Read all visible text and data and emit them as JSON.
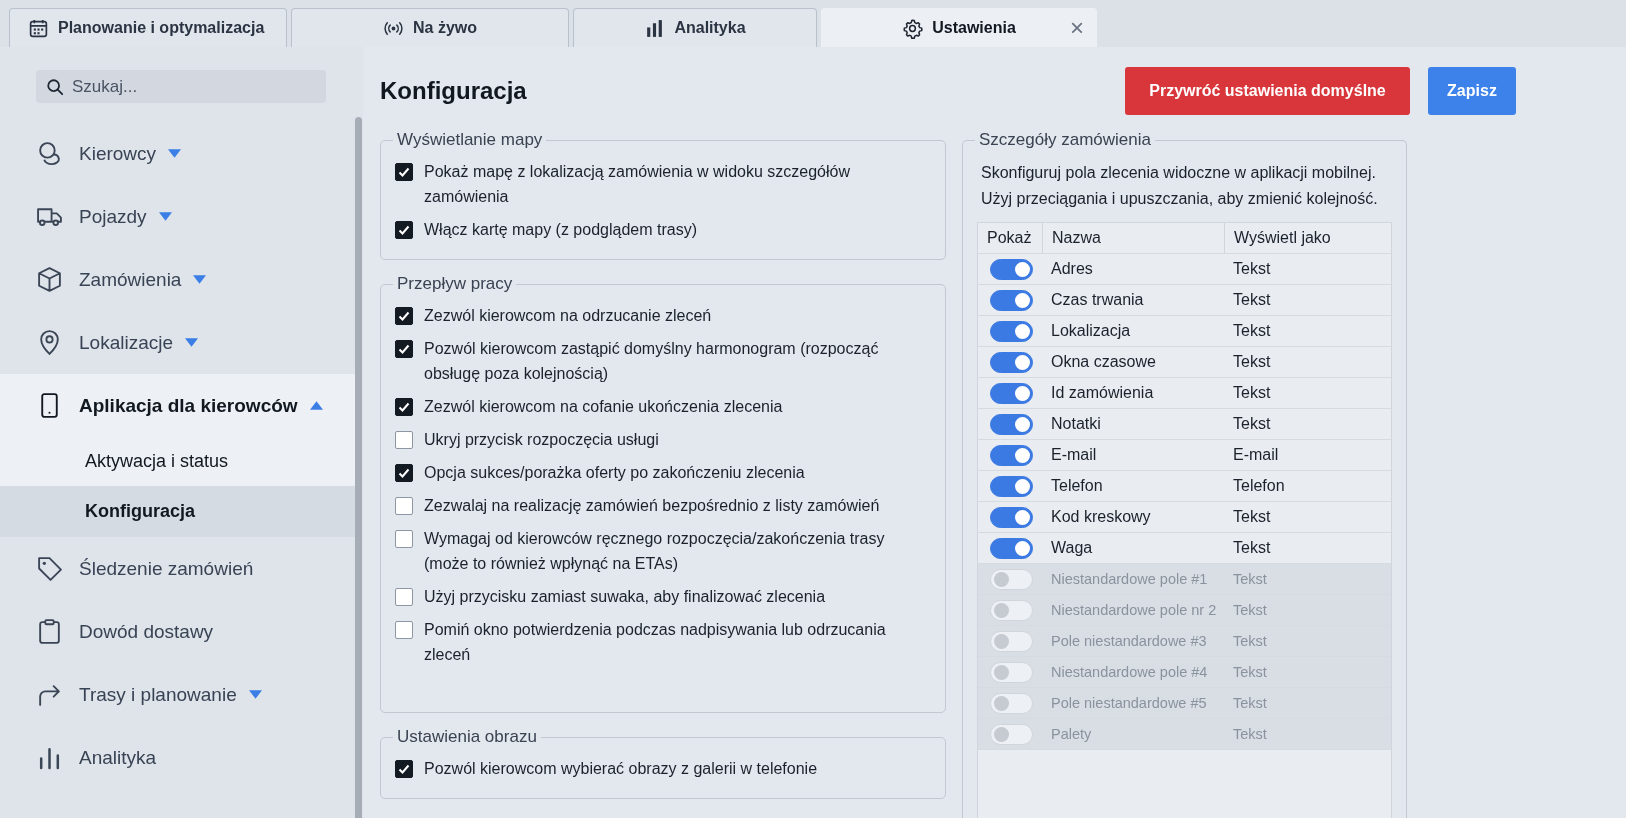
{
  "tabs": [
    {
      "label": "Planowanie i optymalizacja",
      "selected": false
    },
    {
      "label": "Na żywo",
      "selected": false
    },
    {
      "label": "Analityka",
      "selected": false
    },
    {
      "label": "Ustawienia",
      "selected": true,
      "close": "×"
    }
  ],
  "sidebar": {
    "search": {
      "placeholder": "Szukaj..."
    },
    "items": [
      {
        "label": "Kierowcy",
        "expandable": true,
        "expanded": false
      },
      {
        "label": "Pojazdy",
        "expandable": true,
        "expanded": false
      },
      {
        "label": "Zamówienia",
        "expandable": true,
        "expanded": false
      },
      {
        "label": "Lokalizacje",
        "expandable": true,
        "expanded": false
      },
      {
        "label": "Aplikacja dla kierowców",
        "expandable": true,
        "expanded": true,
        "children": [
          {
            "label": "Aktywacja i status",
            "selected": false
          },
          {
            "label": "Konfiguracja",
            "selected": true
          }
        ]
      },
      {
        "label": "Śledzenie zamówień",
        "expandable": false,
        "expanded": false
      },
      {
        "label": "Dowód dostawy",
        "expandable": false,
        "expanded": false
      },
      {
        "label": "Trasy i planowanie",
        "expandable": true,
        "expanded": false
      },
      {
        "label": "Analityka",
        "expandable": false,
        "expanded": false
      }
    ]
  },
  "page": {
    "title": "Konfiguracja",
    "buttons": [
      {
        "label": "Przywróć ustawienia domyślne",
        "kind": "danger"
      },
      {
        "label": "Zapisz",
        "kind": "primary"
      }
    ]
  },
  "groups": [
    {
      "legend": "Wyświetlanie mapy",
      "items": [
        {
          "label": "Pokaż mapę z lokalizacją zamówienia w widoku szczegółów zamówienia",
          "checked": true
        },
        {
          "label": "Włącz kartę mapy (z podglądem trasy)",
          "checked": true
        }
      ]
    },
    {
      "legend": "Przepływ pracy",
      "items": [
        {
          "label": "Zezwól kierowcom na odrzucanie zleceń",
          "checked": true
        },
        {
          "label": "Pozwól kierowcom zastąpić domyślny harmonogram (rozpocząć obsługę poza kolejnością)",
          "checked": true
        },
        {
          "label": "Zezwól kierowcom na cofanie ukończenia zlecenia",
          "checked": true
        },
        {
          "label": "Ukryj przycisk rozpoczęcia usługi",
          "checked": false
        },
        {
          "label": "Opcja sukces/porażka oferty po zakończeniu zlecenia",
          "checked": true
        },
        {
          "label": "Zezwalaj na realizację zamówień bezpośrednio z listy zamówień",
          "checked": false
        },
        {
          "label": "Wymagaj od kierowców ręcznego rozpoczęcia/zakończenia trasy (może to również wpłynąć na ETAs)",
          "checked": false
        },
        {
          "label": "Użyj przycisku zamiast suwaka, aby finalizować zlecenia",
          "checked": false
        },
        {
          "label": "Pomiń okno potwierdzenia podczas nadpisywania lub odrzucania zleceń",
          "checked": false
        }
      ]
    },
    {
      "legend": "Ustawienia obrazu",
      "items": [
        {
          "label": "Pozwól kierowcom wybierać obrazy z galerii w telefonie",
          "checked": true
        }
      ]
    }
  ],
  "order_details": {
    "legend": "Szczegóły zamówienia",
    "description": "Skonfiguruj pola zlecenia widoczne w aplikacji mobilnej. Użyj przeciągania i upuszczania, aby zmienić kolejność.",
    "columns": [
      "Pokaż",
      "Nazwa",
      "Wyświetl jako"
    ],
    "rows": [
      {
        "name": "Adres",
        "display": "Tekst",
        "on": true
      },
      {
        "name": "Czas trwania",
        "display": "Tekst",
        "on": true
      },
      {
        "name": "Lokalizacja",
        "display": "Tekst",
        "on": true
      },
      {
        "name": "Okna czasowe",
        "display": "Tekst",
        "on": true
      },
      {
        "name": "Id zamówienia",
        "display": "Tekst",
        "on": true
      },
      {
        "name": "Notatki",
        "display": "Tekst",
        "on": true
      },
      {
        "name": "E-mail",
        "display": "E-mail",
        "on": true
      },
      {
        "name": "Telefon",
        "display": "Telefon",
        "on": true
      },
      {
        "name": "Kod kreskowy",
        "display": "Tekst",
        "on": true
      },
      {
        "name": "Waga",
        "display": "Tekst",
        "on": true
      },
      {
        "name": "Niestandardowe pole #1",
        "display": "Tekst",
        "on": false
      },
      {
        "name": "Niestandardowe pole nr 2",
        "display": "Tekst",
        "on": false
      },
      {
        "name": "Pole niestandardowe #3",
        "display": "Tekst",
        "on": false
      },
      {
        "name": "Niestandardowe pole #4",
        "display": "Tekst",
        "on": false
      },
      {
        "name": "Pole niestandardowe #5",
        "display": "Tekst",
        "on": false
      },
      {
        "name": "Palety",
        "display": "Tekst",
        "on": false
      }
    ]
  }
}
